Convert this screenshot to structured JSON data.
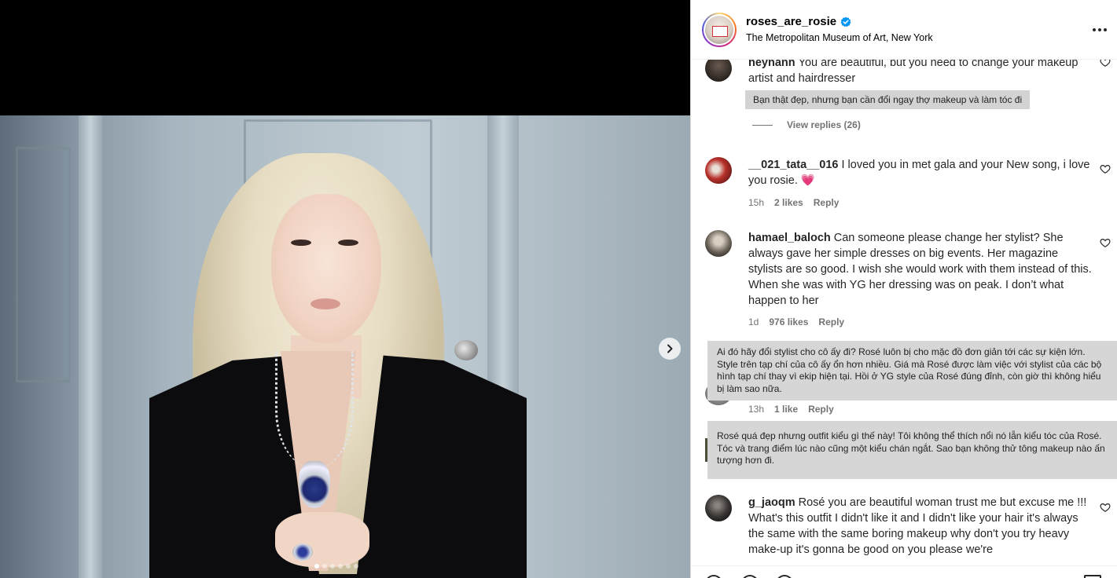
{
  "post": {
    "username": "roses_are_rosie",
    "location": "The Metropolitan Museum of Art, New York",
    "carousel": {
      "slides": 6,
      "active_index": 0
    }
  },
  "colors": {
    "verified": "#0095f6",
    "meta": "#737373",
    "translation_bg": "#d6d6d6"
  },
  "comments": [
    {
      "username": "heynanh",
      "text": "You are beautiful, but you need to change your makeup artist and hairdresser",
      "translation": "Bạn thật đẹp, nhưng bạn cần đổi ngay thợ makeup và làm tóc đi",
      "view_replies": "View replies (26)"
    },
    {
      "username": "__021_tata__016",
      "text": "I loved you in met gala and your New song, i love you rosie. 💗",
      "time": "15h",
      "likes": "2 likes",
      "reply": "Reply"
    },
    {
      "username": "hamael_baloch",
      "text": "Can someone please change her stylist? She always gave her simple dresses on big events. Her magazine stylists are so good. I wish she would work with them instead of this. When she was with YG her dressing was on peak. I don’t what happen to her",
      "time": "1d",
      "likes": "976 likes",
      "reply": "Reply"
    },
    {
      "translation": "Ai đó hãy đổi stylist cho cô ấy đi? Rosé luôn bị cho mặc đồ đơn giản tới các sự kiện lớn. Style trên tạp chí của cô ấy ổn hơn nhiều. Giá mà Rosé được làm việc với stylist của các bộ hình tạp chí thay vì ekip hiện tại. Hồi ở YG style của Rosé đúng đỉnh, còn giờ thì không hiểu bị làm sao nữa.",
      "time": "13h",
      "likes": "1 like",
      "reply": "Reply"
    },
    {
      "translation": "Rosé quá đẹp nhưng outfit kiểu gì thế này! Tôi không thể thích nổi nó lẫn kiểu tóc của Rosé. Tóc và trang điểm lúc nào cũng một kiểu chán ngắt. Sao bạn không thử tông makeup nào ấn tượng hơn đi."
    },
    {
      "username": "g_jaoqm",
      "text": "Rosé you are beautiful woman trust me but excuse me !!! What's this outfit I didn't like it and I didn't like your hair it's always the same with the same boring makeup why don't you try heavy make-up it's gonna be good on you please we're"
    }
  ],
  "icons": {
    "verified": "verified-badge-icon",
    "more": "more-options-icon",
    "like": "heart-icon",
    "next": "chevron-right-icon"
  }
}
